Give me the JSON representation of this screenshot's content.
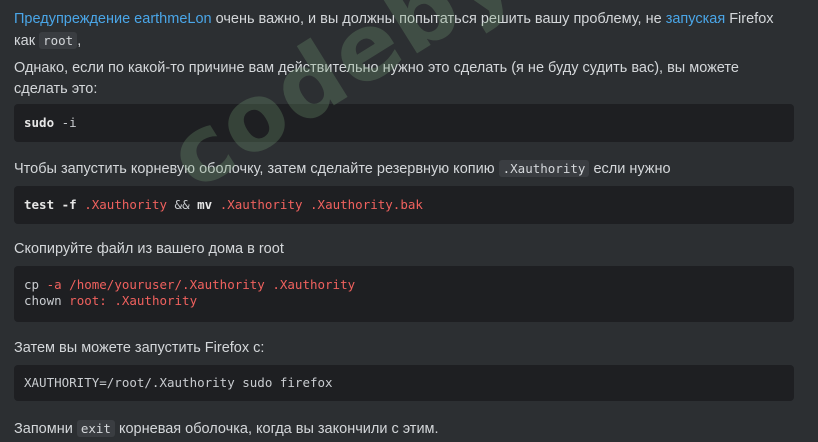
{
  "p1": {
    "link1": "Предупреждение earthmeLon",
    "t1": " очень важно, и вы должны попытаться решить вашу проблему, не ",
    "link2": "запуская",
    "t2": " Firefox как ",
    "code": "root",
    "t3": ","
  },
  "p2": {
    "text": "Однако, если по какой-то причине вам действительно нужно это сделать (я не буду судить вас), вы можете сделать это:"
  },
  "code1": {
    "cmd": "sudo",
    "arg": " -i"
  },
  "p3": {
    "t1": "Чтобы запустить корневую оболочку, затем сделайте резервную копию ",
    "code": ".Xauthority",
    "t2": " если нужно"
  },
  "code2": {
    "kw1": "test",
    "flag": " -f ",
    "f1": ".Xauthority",
    "and": " && ",
    "kw2": "mv",
    "f2": " .Xauthority .Xauthority.bak"
  },
  "p4": {
    "text": "Скопируйте файл из вашего дома в root"
  },
  "code3": {
    "l1_cmd": "cp",
    "l1_rest": " -a /home/youruser/.Xauthority .Xauthority",
    "l2_cmd": "chown",
    "l2_rest": " root: .Xauthority"
  },
  "p5": {
    "text": "Затем вы можете запустить Firefox с:"
  },
  "code4": {
    "text": "XAUTHORITY=/root/.Xauthority sudo firefox"
  },
  "p6": {
    "t1": "Запомни ",
    "code": "exit",
    "t2": " корневая оболочка, когда вы закончили с этим."
  },
  "watermark": "codeby.net"
}
